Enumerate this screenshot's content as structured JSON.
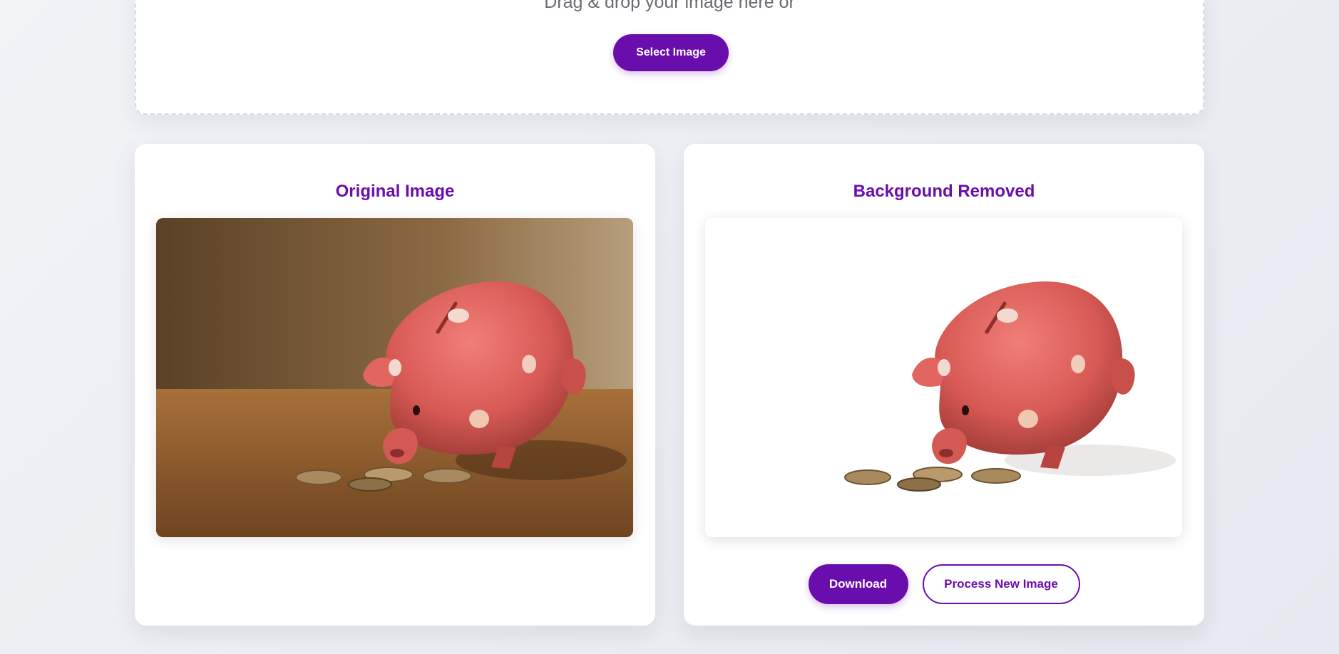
{
  "upload": {
    "drop_text": "Drag & drop your image here or",
    "select_label": "Select Image"
  },
  "original": {
    "title": "Original Image"
  },
  "result": {
    "title": "Background Removed",
    "download_label": "Download",
    "process_new_label": "Process New Image"
  },
  "colors": {
    "accent": "#6a0dad",
    "page_bg": "#eef0f4",
    "card_bg": "#ffffff"
  }
}
